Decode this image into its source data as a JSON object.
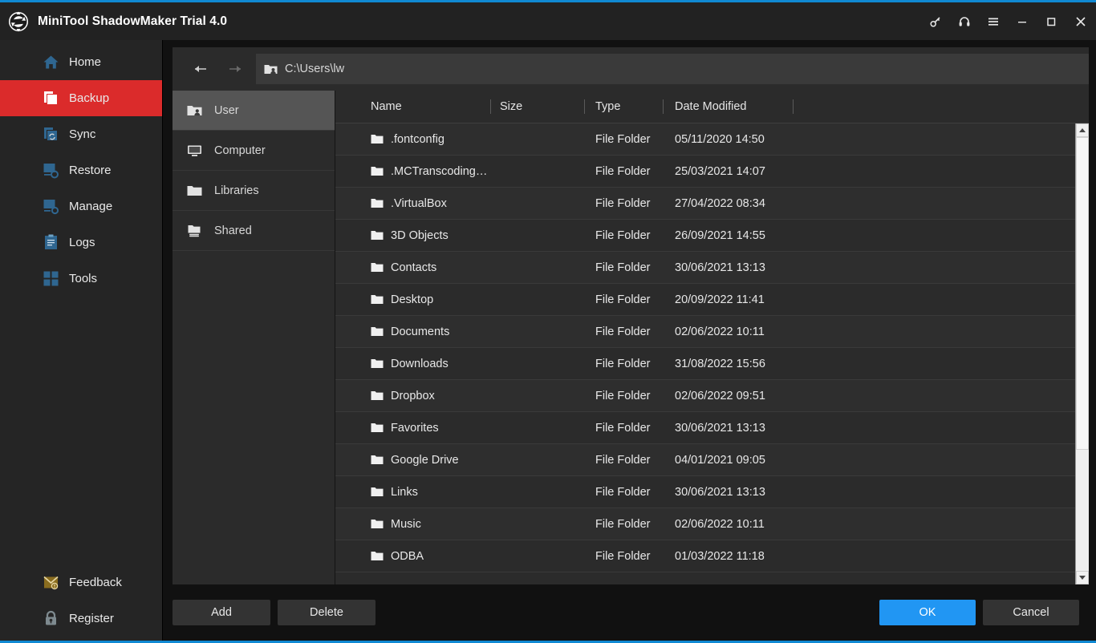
{
  "window": {
    "title": "MiniTool ShadowMaker Trial 4.0",
    "logo_icon": "shadowmaker-logo-icon",
    "accent_red": "#db2b2b",
    "accent_blue": "#1089d3",
    "controls": [
      {
        "name": "key-icon",
        "glyph": "key"
      },
      {
        "name": "headset-icon",
        "glyph": "headset"
      },
      {
        "name": "menu-icon",
        "glyph": "menu"
      },
      {
        "name": "minimize-icon",
        "glyph": "minimize"
      },
      {
        "name": "maximize-icon",
        "glyph": "maximize"
      },
      {
        "name": "close-icon",
        "glyph": "close"
      }
    ]
  },
  "sidebar": {
    "items": [
      {
        "label": "Home",
        "icon": "home-icon",
        "active": false
      },
      {
        "label": "Backup",
        "icon": "backup-icon",
        "active": true
      },
      {
        "label": "Sync",
        "icon": "sync-icon",
        "active": false
      },
      {
        "label": "Restore",
        "icon": "restore-icon",
        "active": false
      },
      {
        "label": "Manage",
        "icon": "manage-icon",
        "active": false
      },
      {
        "label": "Logs",
        "icon": "logs-icon",
        "active": false
      },
      {
        "label": "Tools",
        "icon": "tools-icon",
        "active": false
      }
    ],
    "bottom_items": [
      {
        "label": "Feedback",
        "icon": "feedback-icon"
      },
      {
        "label": "Register",
        "icon": "lock-icon"
      }
    ]
  },
  "dialog": {
    "path": {
      "value": "C:\\Users\\lw",
      "icon": "user-folder-icon",
      "back_icon": "arrow-left-icon",
      "forward_icon": "arrow-right-icon"
    },
    "places": [
      {
        "label": "User",
        "icon": "user-folder-icon",
        "selected": true
      },
      {
        "label": "Computer",
        "icon": "monitor-icon",
        "selected": false
      },
      {
        "label": "Libraries",
        "icon": "folder-icon",
        "selected": false
      },
      {
        "label": "Shared",
        "icon": "shared-folder-icon",
        "selected": false
      }
    ],
    "columns": [
      "Name",
      "Size",
      "Type",
      "Date Modified"
    ],
    "rows": [
      {
        "name": ".fontconfig",
        "size": "",
        "type": "File Folder",
        "date": "05/11/2020 14:50"
      },
      {
        "name": ".MCTranscoding…",
        "size": "",
        "type": "File Folder",
        "date": "25/03/2021 14:07"
      },
      {
        "name": ".VirtualBox",
        "size": "",
        "type": "File Folder",
        "date": "27/04/2022 08:34"
      },
      {
        "name": "3D Objects",
        "size": "",
        "type": "File Folder",
        "date": "26/09/2021 14:55"
      },
      {
        "name": "Contacts",
        "size": "",
        "type": "File Folder",
        "date": "30/06/2021 13:13"
      },
      {
        "name": "Desktop",
        "size": "",
        "type": "File Folder",
        "date": "20/09/2022 11:41"
      },
      {
        "name": "Documents",
        "size": "",
        "type": "File Folder",
        "date": "02/06/2022 10:11"
      },
      {
        "name": "Downloads",
        "size": "",
        "type": "File Folder",
        "date": "31/08/2022 15:56"
      },
      {
        "name": "Dropbox",
        "size": "",
        "type": "File Folder",
        "date": "02/06/2022 09:51"
      },
      {
        "name": "Favorites",
        "size": "",
        "type": "File Folder",
        "date": "30/06/2021 13:13"
      },
      {
        "name": "Google Drive",
        "size": "",
        "type": "File Folder",
        "date": "04/01/2021 09:05"
      },
      {
        "name": "Links",
        "size": "",
        "type": "File Folder",
        "date": "30/06/2021 13:13"
      },
      {
        "name": "Music",
        "size": "",
        "type": "File Folder",
        "date": "02/06/2022 10:11"
      },
      {
        "name": "ODBA",
        "size": "",
        "type": "File Folder",
        "date": "01/03/2022 11:18"
      }
    ],
    "footer": {
      "add_label": "Add",
      "delete_label": "Delete",
      "ok_label": "OK",
      "cancel_label": "Cancel"
    }
  }
}
